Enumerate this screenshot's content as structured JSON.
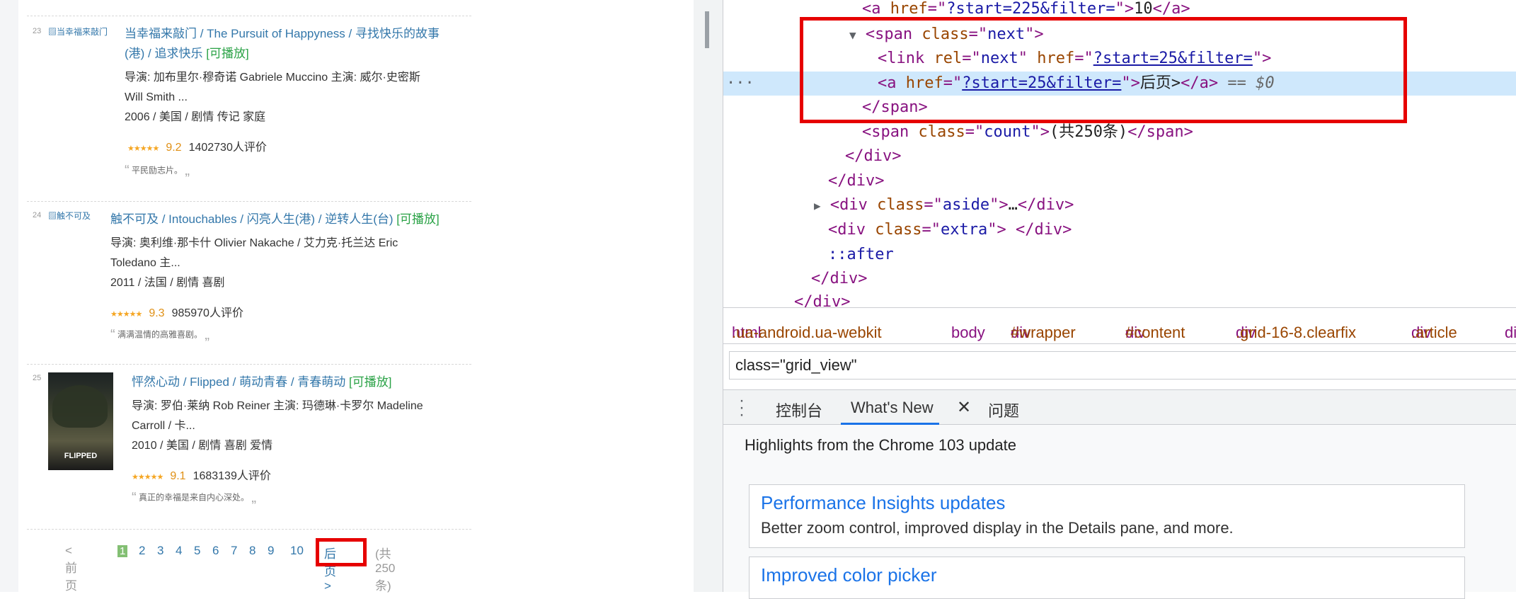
{
  "movies": [
    {
      "rank": "23",
      "image_alt": "当幸福来敲门",
      "title_main": "当幸福来敲门",
      "title_rest": " / The Pursuit of Happyness  / 寻找快乐的故事",
      "title_line2": "(港) / 追求快乐",
      "playable": "[可播放]",
      "director_line1": "导演: 加布里尔·穆奇诺 Gabriele Muccino   主演: 威尔·史密斯",
      "director_line2": "Will Smith ...",
      "info": "2006 / 美国 / 剧情 传记 家庭",
      "stars": "★★★★★",
      "score": "9.2",
      "votes": "1402730人评价",
      "quote": "平民励志片。"
    },
    {
      "rank": "24",
      "image_alt": "触不可及",
      "title_main": "触不可及",
      "title_rest": "  / Intouchables  / 闪亮人生(港) / 逆转人生(台)",
      "playable": "[可播放]",
      "director_line1": "导演: 奥利维·那卡什 Olivier Nakache / 艾力克·托兰达 Eric",
      "director_line2": "Toledano   主...",
      "info": "2011 / 法国 / 剧情 喜剧",
      "stars": "★★★★★",
      "score": "9.3",
      "votes": "985970人评价",
      "quote": "满满温情的高雅喜剧。"
    },
    {
      "rank": "25",
      "poster_text": "FLIPPED",
      "title_main": "怦然心动",
      "title_rest": "  / Flipped  / 萌动青春 / 青春萌动",
      "playable": "[可播放]",
      "director_line1": "导演: 罗伯·莱纳 Rob Reiner   主演: 玛德琳·卡罗尔 Madeline",
      "director_line2": "Carroll / 卡...",
      "info": "2010 / 美国 / 剧情 喜剧 爱情",
      "stars": "★★★★★",
      "score": "9.1",
      "votes": "1683139人评价",
      "quote": "真正的幸福是来自内心深处。"
    }
  ],
  "quote_open": "“",
  "quote_close": "„",
  "pager": {
    "prev": "<前页",
    "pages": [
      "1",
      "2",
      "3",
      "4",
      "5",
      "6",
      "7",
      "8",
      "9",
      "10"
    ],
    "next": "后页>",
    "count": "(共250条)"
  },
  "devtools": {
    "code_lines": [
      {
        "indent": 0,
        "html": "a_start"
      },
      {
        "indent": 0,
        "html": "span_next"
      },
      {
        "indent": 0,
        "html": "link_next"
      },
      {
        "indent": 0,
        "html": "a_next"
      },
      {
        "indent": 0,
        "html": "span_close"
      },
      {
        "indent": 0,
        "html": "span_count"
      },
      {
        "indent": 0,
        "html": "div_close1"
      },
      {
        "indent": 0,
        "html": "div_close2"
      },
      {
        "indent": 0,
        "html": "div_aside"
      },
      {
        "indent": 0,
        "html": "div_extra"
      },
      {
        "indent": 0,
        "html": "after"
      },
      {
        "indent": 0,
        "html": "div_close3"
      },
      {
        "indent": 0,
        "html": "div_close4"
      }
    ],
    "lines": {
      "l1_href": "?start=225&filter=",
      "l1_text": "10",
      "l2_class": "next",
      "l3_rel": "next",
      "l3_href": "?start=25&filter=",
      "l4_href": "?start=25&filter=",
      "l4_text": "后页>",
      "l4_eq": "== $0",
      "l6_class": "count",
      "l6_text": "(共250条)",
      "l9_class": "aside",
      "l10_class": "extra",
      "l11_text": "::after",
      "ellipsis": "…"
    },
    "breadcrumbs": [
      {
        "tag": "html",
        "rest": ".ua-android.ua-webkit"
      },
      {
        "tag": "body",
        "rest": ""
      },
      {
        "tag": "div",
        "rest": "#wrapper"
      },
      {
        "tag": "div",
        "rest": "#content"
      },
      {
        "tag": "div",
        "rest": ".grid-16-8.clearfix"
      },
      {
        "tag": "div",
        "rest": ".article"
      },
      {
        "tag": "di",
        "rest": ""
      }
    ],
    "search_value": "class=\"grid_view\"",
    "tabs": {
      "console": "控制台",
      "whats_new": "What's New",
      "issues": "问题"
    },
    "whats_new": {
      "heading": "Highlights from the Chrome 103 update",
      "cards": [
        {
          "title": "Performance Insights updates",
          "desc": "Better zoom control, improved display in the Details pane, and more."
        },
        {
          "title": "Improved color picker",
          "desc": ""
        }
      ]
    }
  }
}
